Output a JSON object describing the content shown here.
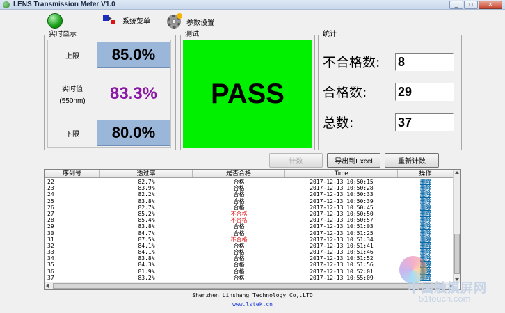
{
  "window": {
    "title": "LENS Transmission Meter V1.0",
    "controls": [
      "_",
      "□",
      "✕"
    ]
  },
  "toolbar": {
    "system_menu": "系统菜单",
    "param_settings": "参数设置"
  },
  "realtime": {
    "group_label": "实时显示",
    "upper_label": "上限",
    "upper_value": "85.0%",
    "current_label": "实时值",
    "current_unit": "(550nm)",
    "current_value": "83.3%",
    "lower_label": "下限",
    "lower_value": "80.0%"
  },
  "test": {
    "group_label": "测试",
    "result": "PASS",
    "result_color": "#00f000"
  },
  "stats": {
    "group_label": "统计",
    "fail_label": "不合格数:",
    "fail_value": "8",
    "pass_label": "合格数:",
    "pass_value": "29",
    "total_label": "总数:",
    "total_value": "37"
  },
  "buttons": {
    "count": "计数",
    "export": "导出到Excel",
    "reset": "重新计数"
  },
  "table": {
    "headers": [
      "序列号",
      "透过率",
      "是否合格",
      "Time",
      "操作"
    ],
    "rows": [
      {
        "id": "22",
        "rate": "82.7%",
        "status": "合格",
        "time": "2017-12-13 10:50:15",
        "action": "删除",
        "fail": false
      },
      {
        "id": "23",
        "rate": "83.9%",
        "status": "合格",
        "time": "2017-12-13 10:50:28",
        "action": "删除",
        "fail": false
      },
      {
        "id": "24",
        "rate": "82.2%",
        "status": "合格",
        "time": "2017-12-13 10:50:33",
        "action": "删除",
        "fail": false
      },
      {
        "id": "25",
        "rate": "83.8%",
        "status": "合格",
        "time": "2017-12-13 10:50:39",
        "action": "删除",
        "fail": false
      },
      {
        "id": "26",
        "rate": "82.7%",
        "status": "合格",
        "time": "2017-12-13 10:50:45",
        "action": "删除",
        "fail": false
      },
      {
        "id": "27",
        "rate": "85.2%",
        "status": "不合格",
        "time": "2017-12-13 10:50:50",
        "action": "删除",
        "fail": true
      },
      {
        "id": "28",
        "rate": "85.4%",
        "status": "不合格",
        "time": "2017-12-13 10:50:57",
        "action": "删除",
        "fail": true
      },
      {
        "id": "29",
        "rate": "83.8%",
        "status": "合格",
        "time": "2017-12-13 10:51:03",
        "action": "删除",
        "fail": false
      },
      {
        "id": "30",
        "rate": "84.7%",
        "status": "合格",
        "time": "2017-12-13 10:51:25",
        "action": "删除",
        "fail": false
      },
      {
        "id": "31",
        "rate": "87.5%",
        "status": "不合格",
        "time": "2017-12-13 10:51:34",
        "action": "删除",
        "fail": true
      },
      {
        "id": "32",
        "rate": "84.1%",
        "status": "合格",
        "time": "2017-12-13 10:51:41",
        "action": "删除",
        "fail": false
      },
      {
        "id": "33",
        "rate": "84.1%",
        "status": "合格",
        "time": "2017-12-13 10:51:46",
        "action": "删除",
        "fail": false
      },
      {
        "id": "34",
        "rate": "83.8%",
        "status": "合格",
        "time": "2017-12-13 10:51:52",
        "action": "删除",
        "fail": false
      },
      {
        "id": "35",
        "rate": "84.3%",
        "status": "合格",
        "time": "2017-12-13 10:51:56",
        "action": "删除",
        "fail": false
      },
      {
        "id": "36",
        "rate": "81.9%",
        "status": "合格",
        "time": "2017-12-13 10:52:01",
        "action": "删除",
        "fail": false
      },
      {
        "id": "37",
        "rate": "83.2%",
        "status": "合格",
        "time": "2017-12-13 10:55:09",
        "action": "删除",
        "fail": false
      }
    ]
  },
  "footer": {
    "company": "Shenzhen Linshang Technology Co,.LTD",
    "link": "www.lstek.cn"
  },
  "watermark": {
    "text_cn": "中国触摸屏网",
    "text_en": "51touch.com"
  }
}
